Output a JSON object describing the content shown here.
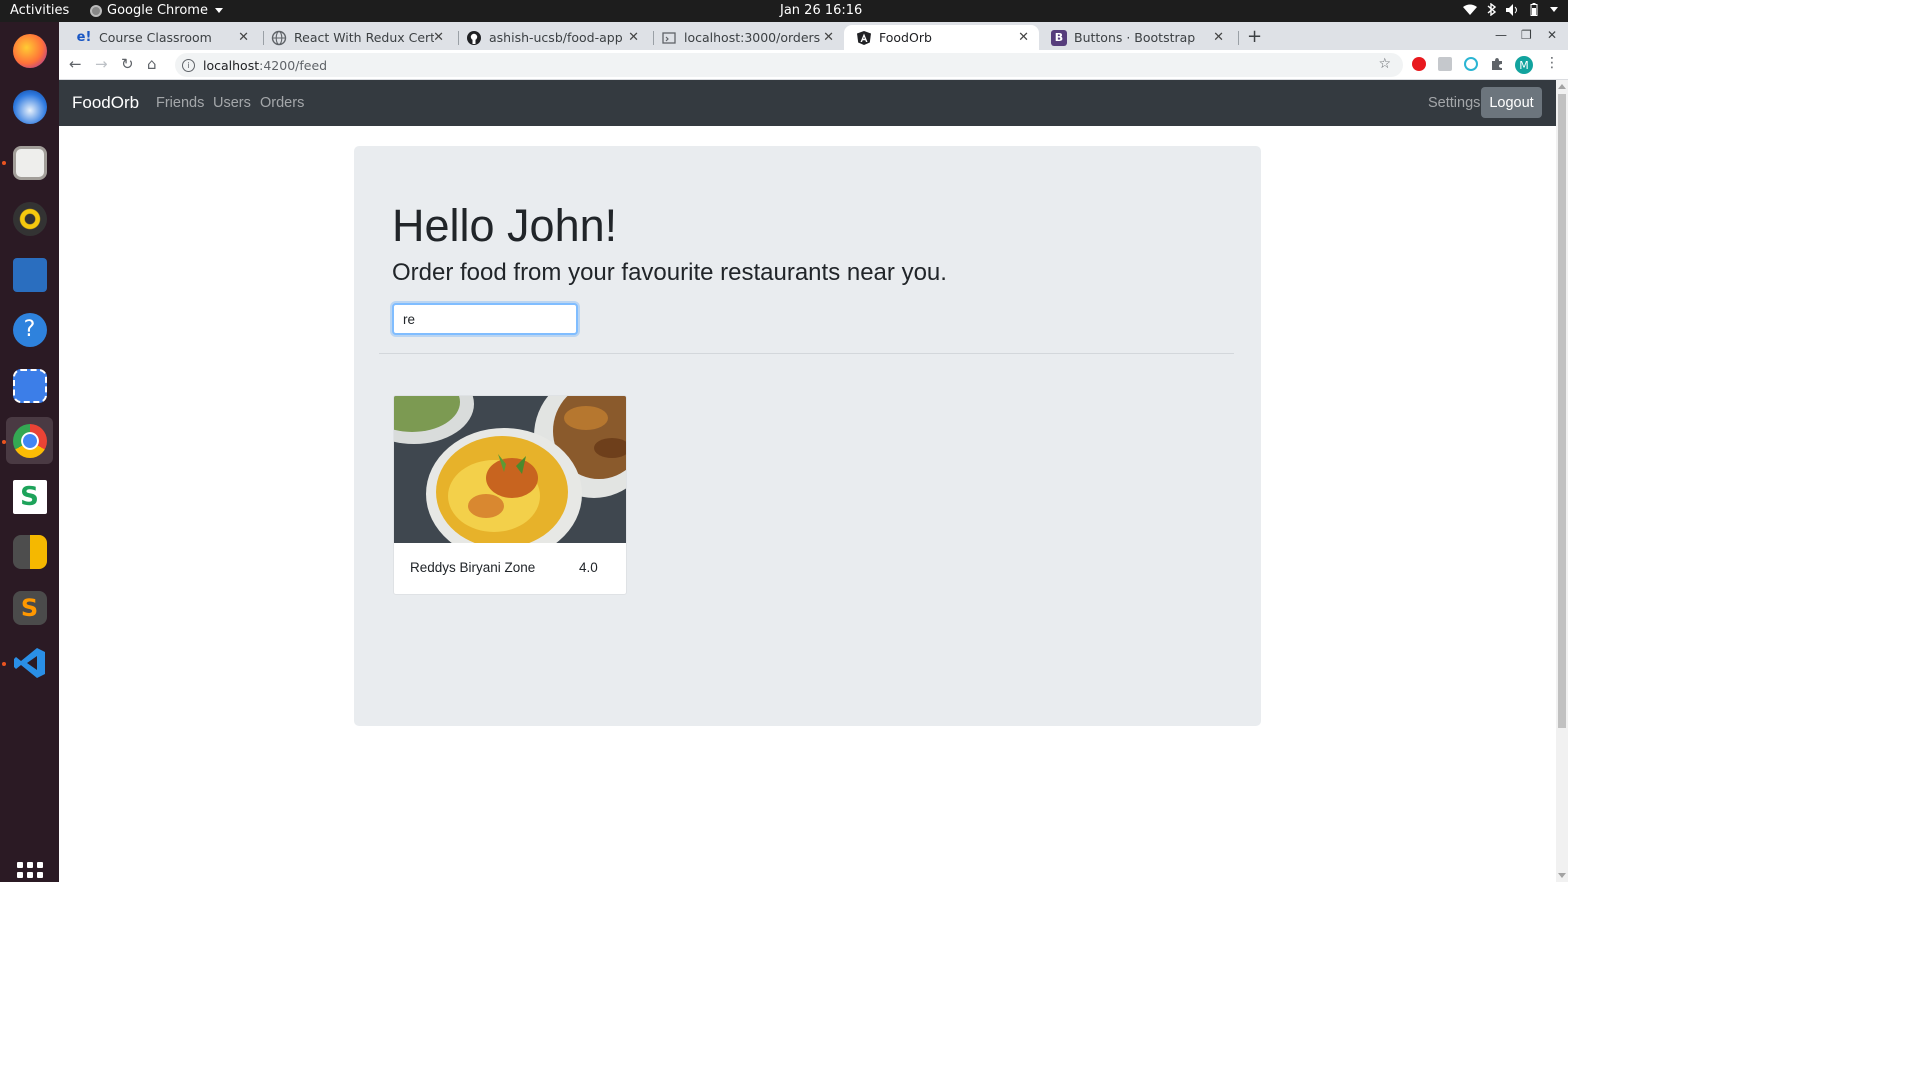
{
  "os": {
    "activities": "Activities",
    "app_name": "Google Chrome",
    "clock": "Jan 26  16:16"
  },
  "browser": {
    "tabs": [
      {
        "title": "Course Classroom",
        "favicon": "e!",
        "favicon_color": "#1a57c4"
      },
      {
        "title": "React With Redux Certific",
        "favicon": "globe-icon",
        "favicon_color": "#5f6368"
      },
      {
        "title": "ashish-ucsb/food-app",
        "favicon": "github-icon",
        "favicon_color": "#202124"
      },
      {
        "title": "localhost:3000/orders",
        "favicon": "devtools-icon",
        "favicon_color": "#5f6368"
      },
      {
        "title": "FoodOrb",
        "favicon": "angular-icon",
        "favicon_color": "#202124"
      },
      {
        "title": "Buttons · Bootstrap",
        "favicon": "B",
        "favicon_color": "#563d7c"
      }
    ],
    "active_tab": 4,
    "url_host": "localhost",
    "url_rest": ":4200/feed",
    "profile_initial": "M"
  },
  "app": {
    "brand": "FoodOrb",
    "nav": [
      "Friends",
      "Users",
      "Orders"
    ],
    "settings": "Settings",
    "logout": "Logout",
    "greeting": "Hello John!",
    "lead": "Order food from your favourite restaurants near you.",
    "search_value": "re",
    "restaurants": [
      {
        "name": "Reddys Biryani Zone",
        "rating": "4.0"
      }
    ]
  },
  "colors": {
    "navbar": "#343a40",
    "jumbotron": "#e9ecef",
    "focus_border": "#80bdff"
  }
}
